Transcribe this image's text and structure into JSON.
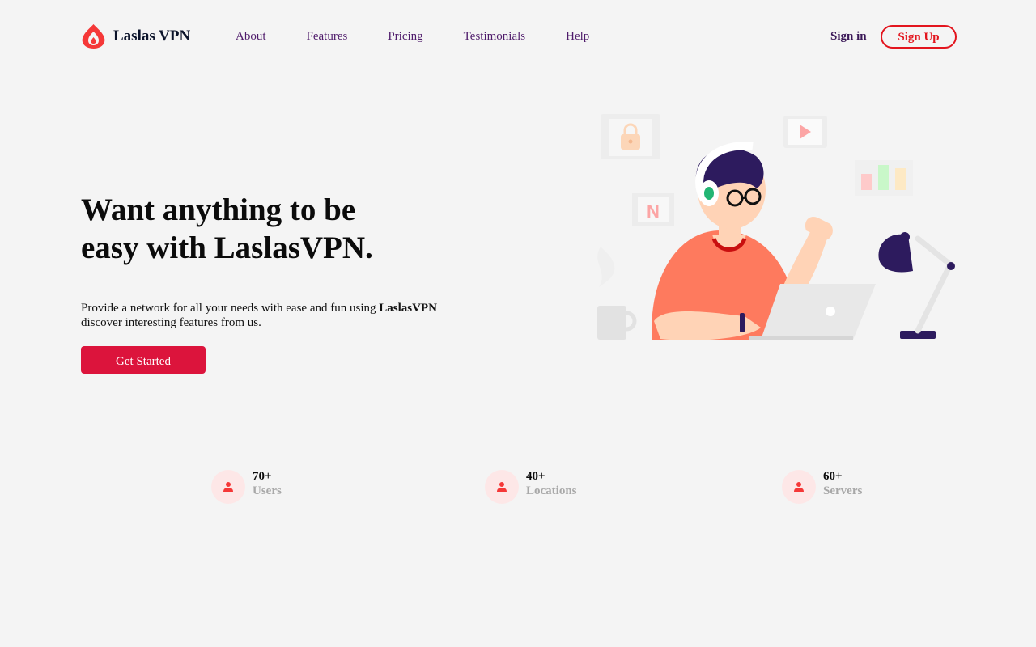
{
  "nav": {
    "brand": "Laslas VPN",
    "links": [
      "About",
      "Features",
      "Pricing",
      "Testimonials",
      "Help"
    ],
    "signin": "Sign in",
    "signup": "Sign Up"
  },
  "hero": {
    "title_line1": "Want anything to be",
    "title_line2": "easy with LaslasVPN.",
    "desc_pre": "Provide a network for all your needs with ease and fun using ",
    "desc_bold": "LaslasVPN",
    "desc_post": "discover interesting features from us.",
    "cta": "Get Started"
  },
  "stats": [
    {
      "value": "70+",
      "label": "Users"
    },
    {
      "value": "40+",
      "label": "Locations"
    },
    {
      "value": "60+",
      "label": "Servers"
    }
  ],
  "colors": {
    "accent": "#dc143c",
    "signup_border": "#e3151e",
    "nav_link": "#4f1b6b",
    "stat_icon_bg": "#fde7e7",
    "stat_icon": "#f53838"
  }
}
